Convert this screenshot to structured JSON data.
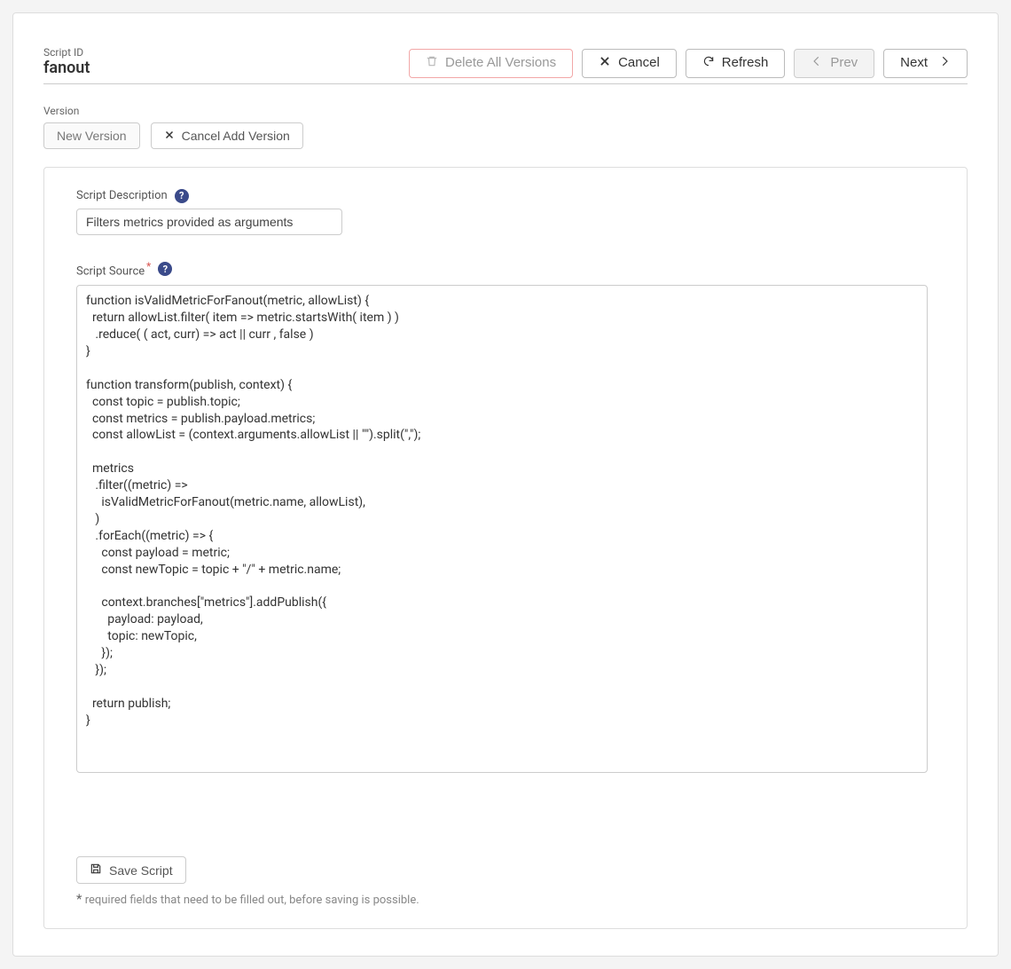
{
  "header": {
    "script_id_label": "Script ID",
    "script_id_value": "fanout"
  },
  "toolbar": {
    "delete_all": "Delete All Versions",
    "cancel": "Cancel",
    "refresh": "Refresh",
    "prev": "Prev",
    "next": "Next"
  },
  "version": {
    "label": "Version",
    "new_version": "New Version",
    "cancel_add": "Cancel Add Version"
  },
  "form": {
    "description_label": "Script Description",
    "description_value": "Filters metrics provided as arguments",
    "source_label": "Script Source",
    "source_value": "function isValidMetricForFanout(metric, allowList) {\n  return allowList.filter( item => metric.startsWith( item ) )\n   .reduce( ( act, curr) => act || curr , false )\n}\n\nfunction transform(publish, context) {\n  const topic = publish.topic;\n  const metrics = publish.payload.metrics;\n  const allowList = (context.arguments.allowList || \"\").split(\",\");\n\n  metrics\n   .filter((metric) =>\n     isValidMetricForFanout(metric.name, allowList),\n   )\n   .forEach((metric) => {\n     const payload = metric;\n     const newTopic = topic + \"/\" + metric.name;\n\n     context.branches[\"metrics\"].addPublish({\n       payload: payload,\n       topic: newTopic,\n     });\n   });\n\n  return publish;\n}"
  },
  "footer": {
    "save": "Save Script",
    "required_hint": "required fields that need to be filled out, before saving is possible."
  }
}
